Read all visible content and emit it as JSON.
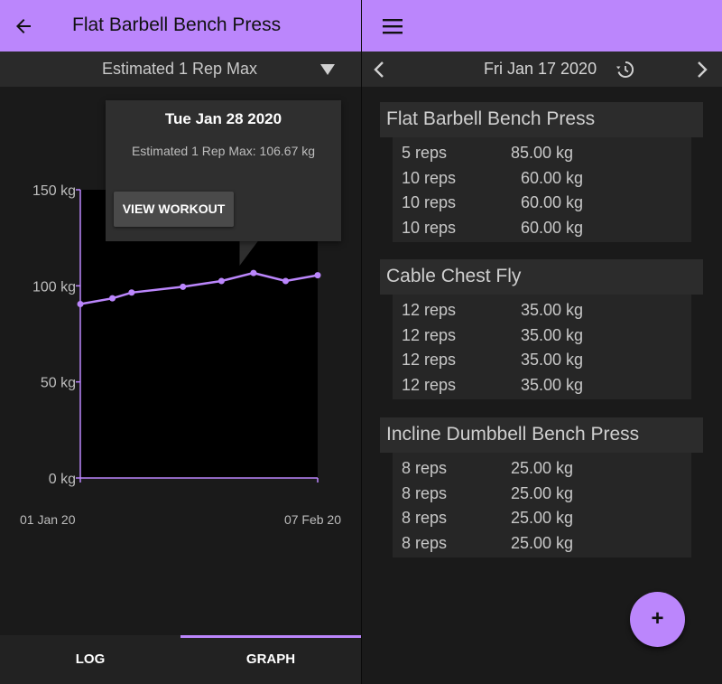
{
  "left": {
    "title": "Flat Barbell Bench Press",
    "metric_select": "Estimated 1 Rep Max",
    "tooltip": {
      "date": "Tue Jan 28 2020",
      "description": "Estimated 1 Rep Max: 106.67 kg",
      "button": "VIEW WORKOUT"
    },
    "tabs": {
      "log": "LOG",
      "graph": "GRAPH",
      "selected": "graph"
    }
  },
  "chart_data": {
    "type": "line",
    "title": "",
    "xlabel": "",
    "ylabel": "",
    "ylim": [
      0,
      150
    ],
    "yticks": [
      "0 kg",
      "50 kg",
      "100 kg",
      "150 kg"
    ],
    "xticks": [
      "01 Jan 20",
      "07 Feb 20"
    ],
    "x": [
      "2020-01-01",
      "2020-01-06",
      "2020-01-09",
      "2020-01-17",
      "2020-01-23",
      "2020-01-28",
      "2020-02-02",
      "2020-02-07"
    ],
    "values": [
      90.5,
      93.5,
      96.5,
      99.5,
      102.5,
      106.67,
      102.5,
      105.5
    ],
    "highlighted_point": "2020-01-28",
    "line_color": "#bb86fc"
  },
  "right": {
    "date": "Fri Jan 17 2020",
    "exercises": [
      {
        "name": "Flat Barbell Bench Press",
        "sets": [
          {
            "reps": "5 reps",
            "weight": "85.00 kg"
          },
          {
            "reps": "10 reps",
            "weight": "60.00 kg"
          },
          {
            "reps": "10 reps",
            "weight": "60.00 kg"
          },
          {
            "reps": "10 reps",
            "weight": "60.00 kg"
          }
        ]
      },
      {
        "name": "Cable Chest Fly",
        "sets": [
          {
            "reps": "12 reps",
            "weight": "35.00 kg"
          },
          {
            "reps": "12 reps",
            "weight": "35.00 kg"
          },
          {
            "reps": "12 reps",
            "weight": "35.00 kg"
          },
          {
            "reps": "12 reps",
            "weight": "35.00 kg"
          }
        ]
      },
      {
        "name": "Incline Dumbbell Bench Press",
        "sets": [
          {
            "reps": "8 reps",
            "weight": "25.00 kg"
          },
          {
            "reps": "8 reps",
            "weight": "25.00 kg"
          },
          {
            "reps": "8 reps",
            "weight": "25.00 kg"
          },
          {
            "reps": "8 reps",
            "weight": "25.00 kg"
          }
        ]
      }
    ],
    "fab": "+"
  },
  "icons": {
    "back": "arrow-left-icon",
    "menu": "hamburger-menu-icon",
    "prev": "chevron-left-icon",
    "next": "chevron-right-icon",
    "history": "history-icon",
    "dropdown": "dropdown-triangle-icon"
  },
  "colors": {
    "accent": "#bb86fc",
    "background": "#1a1a1a",
    "panel": "#2a2a2a"
  }
}
